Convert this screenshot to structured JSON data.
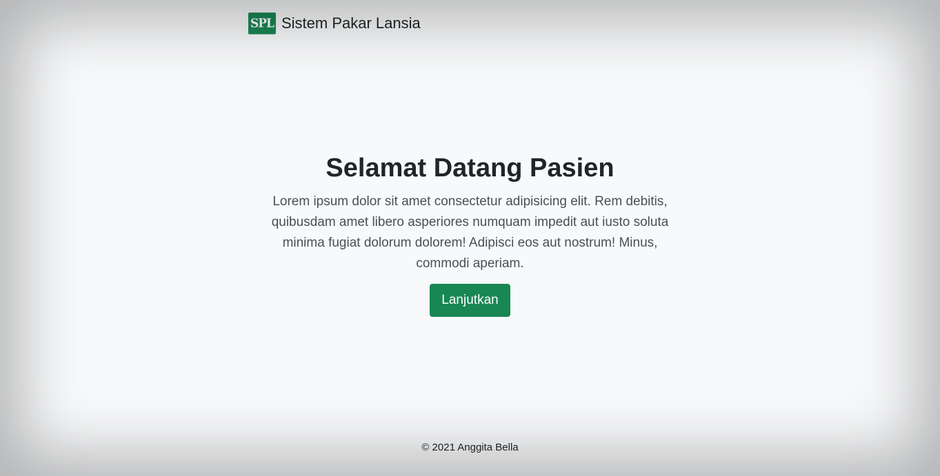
{
  "navbar": {
    "logo_text": "SPL",
    "brand": "Sistem Pakar Lansia"
  },
  "hero": {
    "title": "Selamat Datang Pasien",
    "description": "Lorem ipsum dolor sit amet consectetur adipisicing elit. Rem debitis, quibusdam amet libero asperiores numquam impedit aut iusto soluta minima fugiat dolorum dolorem! Adipisci eos aut nostrum! Minus, commodi aperiam.",
    "button_label": "Lanjutkan"
  },
  "footer": {
    "text": "© 2021 Anggita Bella"
  },
  "colors": {
    "brand_green": "#198754",
    "background": "#f8f9fa",
    "text": "#212529"
  }
}
